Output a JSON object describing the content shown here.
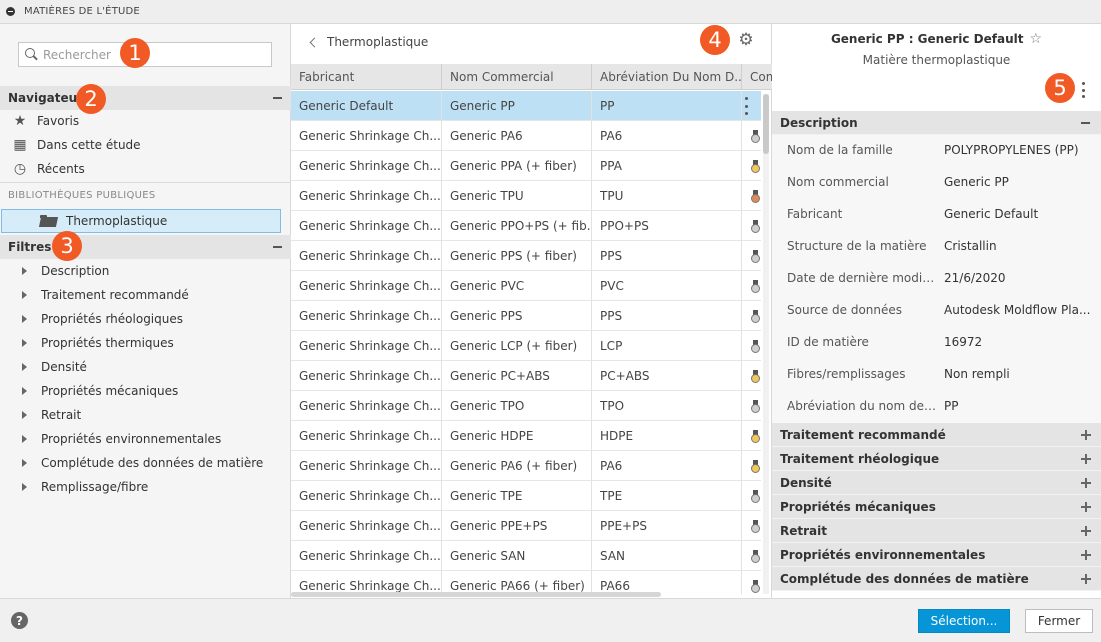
{
  "window": {
    "title": "MATIÈRES DE L'ÉTUDE"
  },
  "search": {
    "placeholder": "Rechercher"
  },
  "badges": [
    "1",
    "2",
    "3",
    "4",
    "5"
  ],
  "navigator": {
    "title": "Navigateur",
    "items": [
      {
        "label": "Favoris",
        "icon": "star-icon"
      },
      {
        "label": "Dans cette étude",
        "icon": "study-icon"
      },
      {
        "label": "Récents",
        "icon": "clock-icon"
      }
    ]
  },
  "libraries": {
    "label": "BIBLIOTHÈQUES PUBLIQUES",
    "items": [
      {
        "label": "Thermoplastique",
        "icon": "folder-open-icon"
      }
    ]
  },
  "filters": {
    "title": "Filtres",
    "items": [
      "Description",
      "Traitement recommandé",
      "Propriétés rhéologiques",
      "Propriétés thermiques",
      "Densité",
      "Propriétés mécaniques",
      "Retrait",
      "Propriétés environnementales",
      "Complétude des données de matière",
      "Remplissage/fibre"
    ]
  },
  "materials": {
    "breadcrumb": "Thermoplastique",
    "columns": [
      "Fabricant",
      "Nom Commercial",
      "Abréviation Du Nom D...",
      "Com"
    ],
    "rows": [
      {
        "fabricant": "Generic Default",
        "nom": "Generic PP",
        "abrev": "PP",
        "medal": "none",
        "selected": true
      },
      {
        "fabricant": "Generic Shrinkage Ch...",
        "nom": "Generic PA6",
        "abrev": "PA6",
        "medal": "silver"
      },
      {
        "fabricant": "Generic Shrinkage Ch...",
        "nom": "Generic PPA (+ fiber)",
        "abrev": "PPA",
        "medal": "gold"
      },
      {
        "fabricant": "Generic Shrinkage Ch...",
        "nom": "Generic TPU",
        "abrev": "TPU",
        "medal": "bronze"
      },
      {
        "fabricant": "Generic Shrinkage Ch...",
        "nom": "Generic PPO+PS (+ fib...",
        "abrev": "PPO+PS",
        "medal": "silver"
      },
      {
        "fabricant": "Generic Shrinkage Ch...",
        "nom": "Generic PPS (+ fiber)",
        "abrev": "PPS",
        "medal": "silver"
      },
      {
        "fabricant": "Generic Shrinkage Ch...",
        "nom": "Generic PVC",
        "abrev": "PVC",
        "medal": "silver"
      },
      {
        "fabricant": "Generic Shrinkage Ch...",
        "nom": "Generic PPS",
        "abrev": "PPS",
        "medal": "silver"
      },
      {
        "fabricant": "Generic Shrinkage Ch...",
        "nom": "Generic LCP (+ fiber)",
        "abrev": "LCP",
        "medal": "silver"
      },
      {
        "fabricant": "Generic Shrinkage Ch...",
        "nom": "Generic PC+ABS",
        "abrev": "PC+ABS",
        "medal": "gold"
      },
      {
        "fabricant": "Generic Shrinkage Ch...",
        "nom": "Generic TPO",
        "abrev": "TPO",
        "medal": "silver"
      },
      {
        "fabricant": "Generic Shrinkage Ch...",
        "nom": "Generic HDPE",
        "abrev": "HDPE",
        "medal": "gold"
      },
      {
        "fabricant": "Generic Shrinkage Ch...",
        "nom": "Generic PA6 (+ fiber)",
        "abrev": "PA6",
        "medal": "gold"
      },
      {
        "fabricant": "Generic Shrinkage Ch...",
        "nom": "Generic TPE",
        "abrev": "TPE",
        "medal": "silver"
      },
      {
        "fabricant": "Generic Shrinkage Ch...",
        "nom": "Generic PPE+PS",
        "abrev": "PPE+PS",
        "medal": "silver"
      },
      {
        "fabricant": "Generic Shrinkage Ch...",
        "nom": "Generic SAN",
        "abrev": "SAN",
        "medal": "silver"
      },
      {
        "fabricant": "Generic Shrinkage Ch...",
        "nom": "Generic PA66 (+ fiber)",
        "abrev": "PA66",
        "medal": "silver"
      }
    ]
  },
  "details": {
    "title": "Generic PP : Generic Default",
    "subtitle": "Matière thermoplastique",
    "description_title": "Description",
    "properties": [
      {
        "label": "Nom de la famille",
        "value": "POLYPROPYLENES (PP)"
      },
      {
        "label": "Nom commercial",
        "value": "Generic PP"
      },
      {
        "label": "Fabricant",
        "value": "Generic Default"
      },
      {
        "label": "Structure de la matière",
        "value": "Cristallin"
      },
      {
        "label": "Date de dernière modifi...",
        "value": "21/6/2020"
      },
      {
        "label": "Source de données",
        "value": "Autodesk Moldflow Pla..."
      },
      {
        "label": "ID de matière",
        "value": "16972"
      },
      {
        "label": "Fibres/remplissages",
        "value": "Non rempli"
      },
      {
        "label": "Abréviation du nom de ...",
        "value": "PP"
      }
    ],
    "sections": [
      "Traitement recommandé",
      "Traitement rhéologique",
      "Densité",
      "Propriétés mécaniques",
      "Retrait",
      "Propriétés environnementales",
      "Complétude des données de matière"
    ]
  },
  "footer": {
    "select_label": "Sélection...",
    "close_label": "Fermer"
  },
  "colors": {
    "accent": "#0696d7",
    "badge": "#f15a24",
    "selection": "#bde0f4",
    "gold": "#f2c75c",
    "silver": "#cfcfcf",
    "bronze": "#e08a5a"
  }
}
